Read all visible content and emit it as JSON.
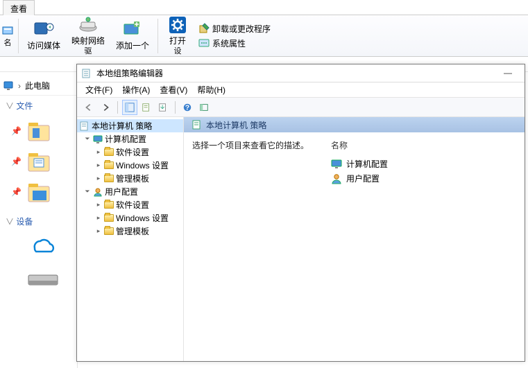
{
  "tab": "查看",
  "ribbon": {
    "items": [
      {
        "label": "名",
        "label2": ""
      },
      {
        "label": "访问媒体",
        "label2": ""
      },
      {
        "label": "映射网络",
        "label2": "驱"
      },
      {
        "label": "添加一个",
        "label2": ""
      },
      {
        "label": "打开",
        "label2": "设"
      }
    ],
    "side": [
      "卸载或更改程序",
      "系统属性"
    ]
  },
  "breadcrumb": "此电脑",
  "sidebar": {
    "section1": "文件",
    "section2": "设备"
  },
  "mmc": {
    "title": "本地组策略编辑器",
    "menu": [
      "文件(F)",
      "操作(A)",
      "查看(V)",
      "帮助(H)"
    ],
    "tree": {
      "root": "本地计算机 策略",
      "n1": "计算机配置",
      "n1a": "软件设置",
      "n1b": "Windows 设置",
      "n1c": "管理模板",
      "n2": "用户配置",
      "n2a": "软件设置",
      "n2b": "Windows 设置",
      "n2c": "管理模板"
    },
    "contentHeader": "本地计算机 策略",
    "description": "选择一个项目来查看它的描述。",
    "listHeader": "名称",
    "list": [
      "计算机配置",
      "用户配置"
    ]
  }
}
